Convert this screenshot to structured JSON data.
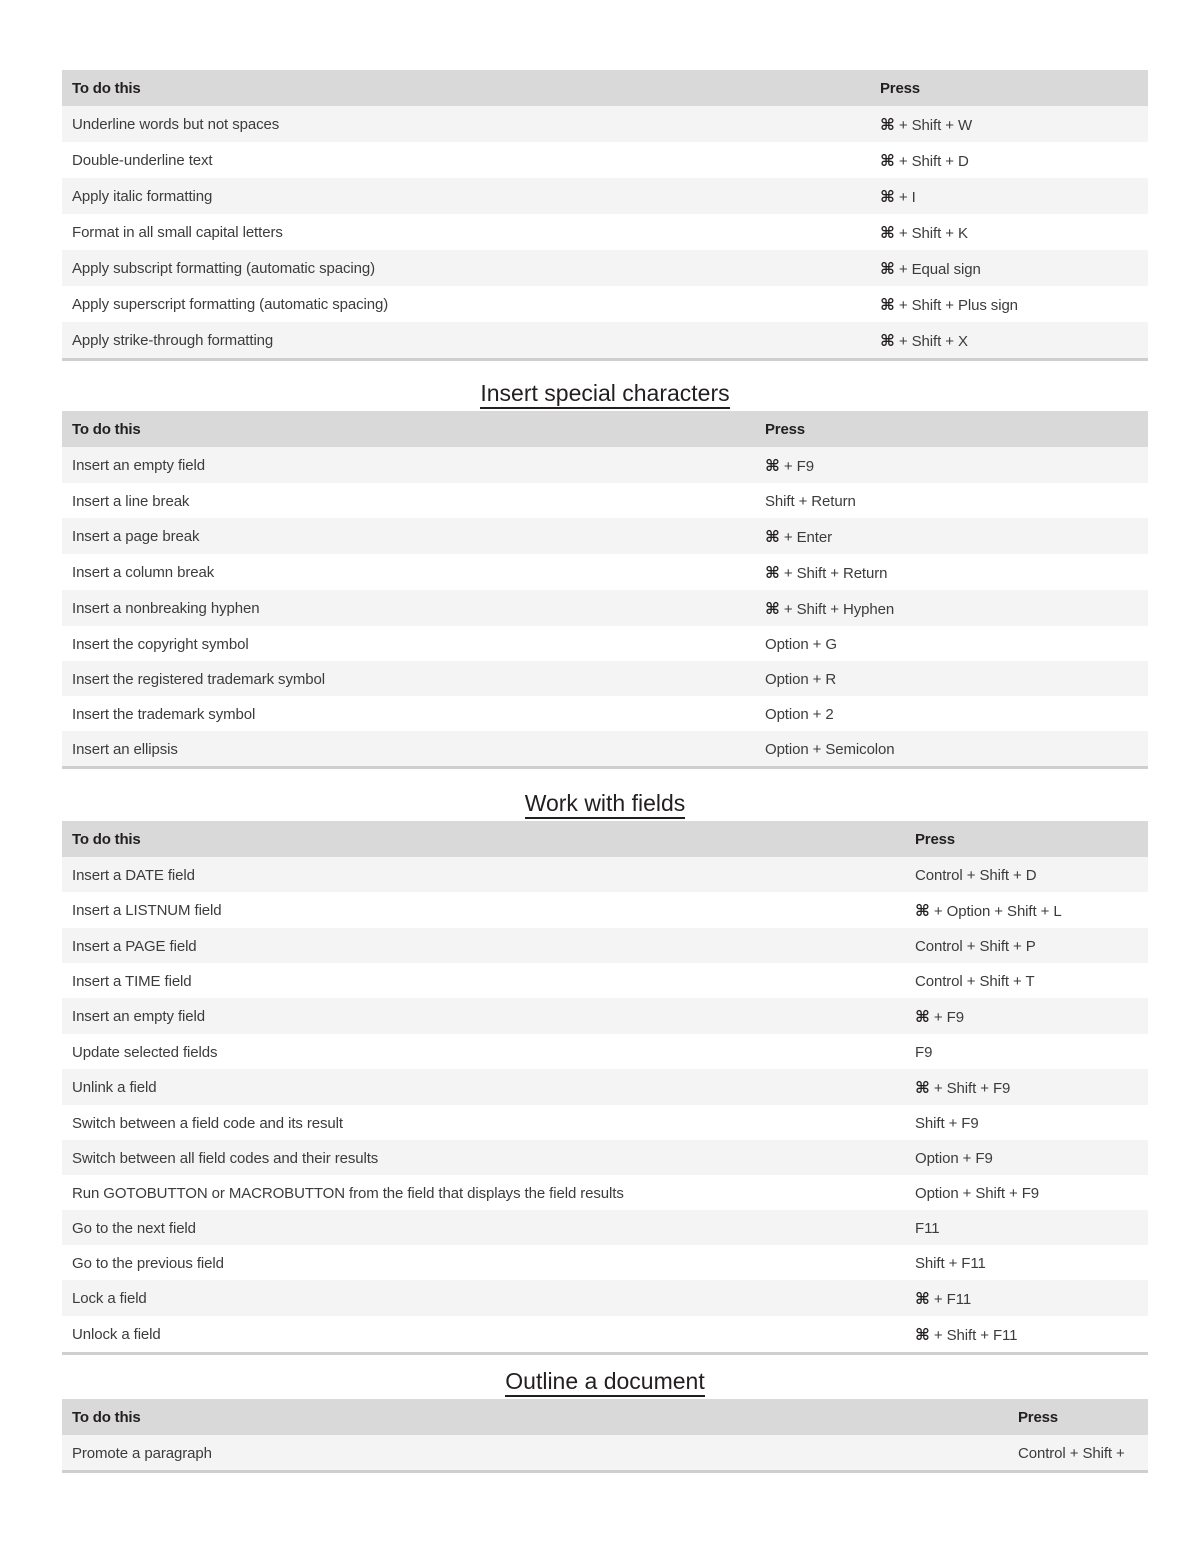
{
  "document": {
    "column_headers": {
      "action": "To do this",
      "press": "Press"
    },
    "command_symbol": "⌘"
  },
  "sections": [
    {
      "heading": "",
      "action_col_width": 808,
      "press_col_width": 278,
      "press_align": "left",
      "rows": [
        {
          "action": "Underline words but not spaces",
          "press_cmd": true,
          "press": "+ Shift + W"
        },
        {
          "action": "Double-underline text",
          "press_cmd": true,
          "press": "+ Shift + D"
        },
        {
          "action": "Apply italic formatting",
          "press_cmd": true,
          "press": "+ I"
        },
        {
          "action": "Format in all small capital letters",
          "press_cmd": true,
          "press": "+ Shift + K"
        },
        {
          "action": "Apply subscript formatting (automatic spacing)",
          "press_cmd": true,
          "press": "+ Equal sign"
        },
        {
          "action": "Apply superscript formatting (automatic spacing)",
          "press_cmd": true,
          "press": "+ Shift + Plus sign"
        },
        {
          "action": "Apply strike-through formatting",
          "press_cmd": true,
          "press": "+ Shift + X"
        }
      ]
    },
    {
      "heading": "Insert special characters",
      "action_col_width": 693,
      "press_col_width": 393,
      "press_align": "left",
      "rows": [
        {
          "action": "Insert an empty field",
          "press_cmd": true,
          "press": "+ F9"
        },
        {
          "action": "Insert a line break",
          "press_cmd": false,
          "press": "Shift + Return"
        },
        {
          "action": "Insert a page break",
          "press_cmd": true,
          "press": "+ Enter"
        },
        {
          "action": "Insert a column break",
          "press_cmd": true,
          "press": "+ Shift + Return"
        },
        {
          "action": "Insert a nonbreaking hyphen",
          "press_cmd": true,
          "press": "+ Shift + Hyphen"
        },
        {
          "action": "Insert the copyright symbol",
          "press_cmd": false,
          "press": "Option + G"
        },
        {
          "action": "Insert the registered trademark symbol",
          "press_cmd": false,
          "press": "Option + R"
        },
        {
          "action": "Insert the trademark symbol",
          "press_cmd": false,
          "press": "Option + 2"
        },
        {
          "action": "Insert an ellipsis",
          "press_cmd": false,
          "press": "Option + Semicolon"
        }
      ]
    },
    {
      "heading": "Work with fields",
      "action_col_width": 843,
      "press_col_width": 243,
      "press_align": "left",
      "rows": [
        {
          "action": "Insert a DATE field",
          "press_cmd": false,
          "press": "Control + Shift + D"
        },
        {
          "action": "Insert a LISTNUM field",
          "press_cmd": true,
          "press": "+ Option + Shift + L"
        },
        {
          "action": "Insert a PAGE field",
          "press_cmd": false,
          "press": "Control + Shift + P"
        },
        {
          "action": "Insert a TIME field",
          "press_cmd": false,
          "press": "Control + Shift + T"
        },
        {
          "action": "Insert an empty field",
          "press_cmd": true,
          "press": "+ F9"
        },
        {
          "action": "Update selected fields",
          "press_cmd": false,
          "press": "F9"
        },
        {
          "action": "Unlink a field",
          "press_cmd": true,
          "press": "+ Shift + F9"
        },
        {
          "action": "Switch between a field code and its result",
          "press_cmd": false,
          "press": "Shift + F9"
        },
        {
          "action": "Switch between all field codes and their results",
          "press_cmd": false,
          "press": "Option + F9"
        },
        {
          "action": "Run GOTOBUTTON or MACROBUTTON from the field that displays the field results",
          "press_cmd": false,
          "press": "Option + Shift + F9"
        },
        {
          "action": "Go to the next field",
          "press_cmd": false,
          "press": "F11"
        },
        {
          "action": "Go to the previous field",
          "press_cmd": false,
          "press": "Shift + F11"
        },
        {
          "action": "Lock a field",
          "press_cmd": true,
          "press": "+ F11"
        },
        {
          "action": "Unlock a field",
          "press_cmd": true,
          "press": "+ Shift + F11"
        }
      ]
    },
    {
      "heading": "Outline a document",
      "action_col_width": 946,
      "press_col_width": 140,
      "press_align": "right",
      "rows": [
        {
          "action": "Promote a paragraph",
          "press_cmd": false,
          "press": "Control + Shift +"
        }
      ]
    }
  ]
}
